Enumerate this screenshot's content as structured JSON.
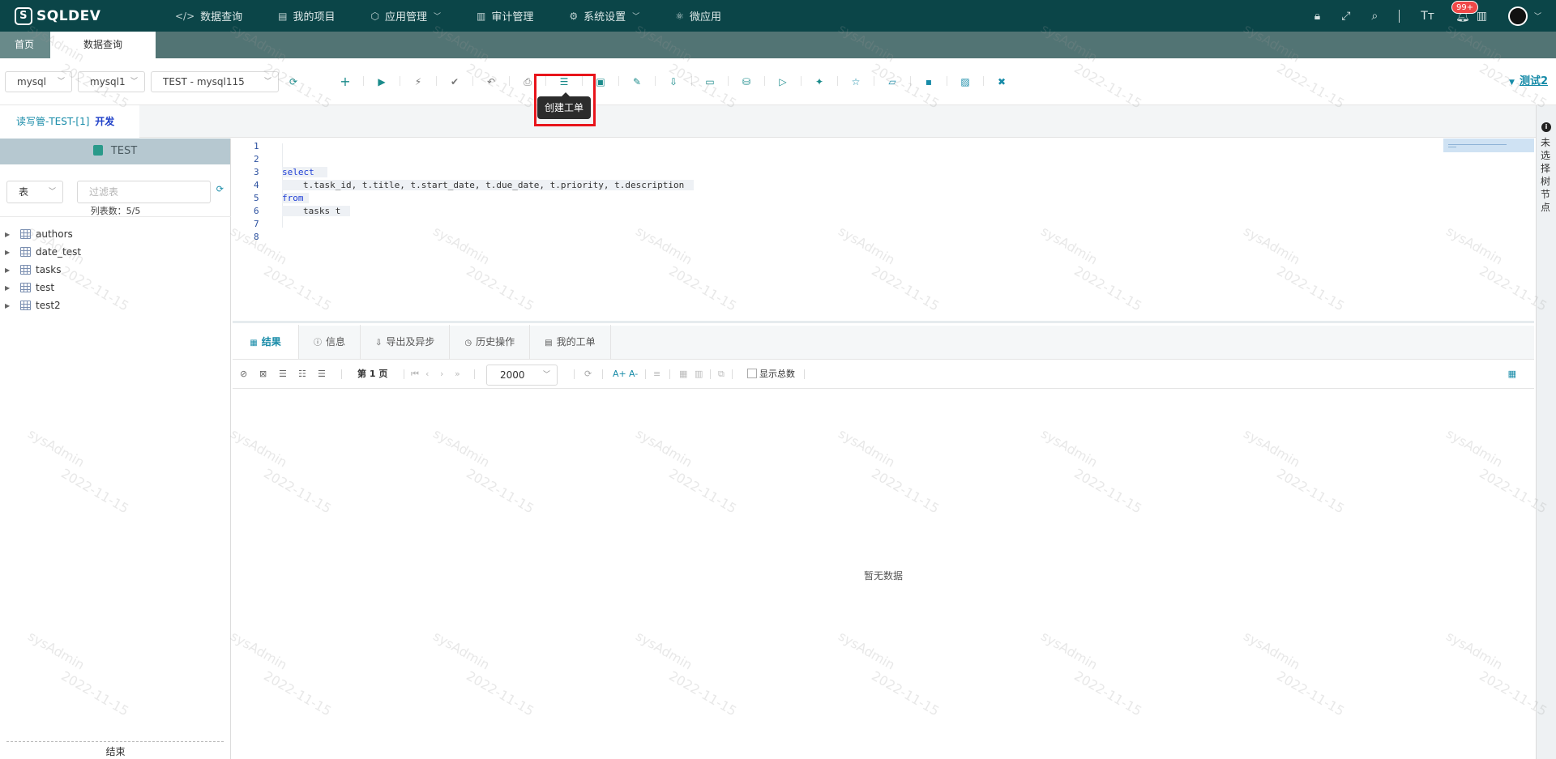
{
  "app": {
    "logo_text": "SQLDEV"
  },
  "nav": {
    "items": [
      {
        "label": "数据查询",
        "icon": "code-icon"
      },
      {
        "label": "我的项目",
        "icon": "book-icon"
      },
      {
        "label": "应用管理",
        "icon": "box-icon",
        "dropdown": true
      },
      {
        "label": "审计管理",
        "icon": "report-icon"
      },
      {
        "label": "系统设置",
        "icon": "gear-icon",
        "dropdown": true
      },
      {
        "label": "微应用",
        "icon": "atom-icon"
      }
    ],
    "notification_badge": "99+"
  },
  "page_tabs": [
    {
      "label": "首页"
    },
    {
      "label": "数据查询"
    }
  ],
  "toolbar": {
    "db_type": "mysql",
    "db_instance": "mysql1",
    "connection": "TEST - mysql115",
    "tooltip": "创建工单",
    "user_link": "测试2"
  },
  "conn_tab": {
    "label": "读写管-TEST-[1]",
    "env": "开发"
  },
  "left_panel": {
    "schema": "TEST",
    "object_type": "表",
    "filter_placeholder": "过滤表",
    "count_text": "列表数：5/5",
    "tables": [
      "authors",
      "date_test",
      "tasks",
      "test",
      "test2"
    ],
    "end_text": "结束"
  },
  "editor": {
    "line_numbers": [
      "1",
      "2",
      "3",
      "4",
      "5",
      "6",
      "7",
      "8"
    ],
    "lines": {
      "l3": "select",
      "l4": "t.task_id, t.title, t.start_date, t.due_date, t.priority, t.description",
      "l5": "from",
      "l6": "tasks t"
    }
  },
  "results": {
    "tabs": [
      {
        "label": "结果"
      },
      {
        "label": "信息"
      },
      {
        "label": "导出及异步"
      },
      {
        "label": "历史操作"
      },
      {
        "label": "我的工单"
      }
    ],
    "page_label": "第 1 页",
    "page_size": "2000",
    "show_total_label": "显示总数",
    "font_increase": "A+",
    "font_decrease": "A-",
    "empty_text": "暂无数据"
  },
  "right_rail": {
    "text": "未选择树节点"
  },
  "watermark": "sysAdmin 2022-11-15",
  "colors": {
    "nav_bg": "#0b4548",
    "accent": "#178ba8",
    "highlight": "#e8141b"
  }
}
